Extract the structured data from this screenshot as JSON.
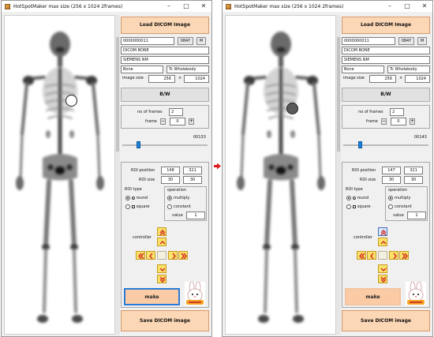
{
  "arrow_color": "#e11919",
  "windows": [
    {
      "title": "HotSpotMaker  max size (256 x 1024 2frames)",
      "load_button": "Load DICOM Image",
      "patient_id": "0000000011",
      "age": "084Y",
      "sex": "M",
      "study": "DICOM BONE",
      "manufacturer": "SIEMENS NM",
      "body_part": "Bone",
      "protocol": "Tc Wholebody",
      "image_size_label": "image size",
      "width": "256",
      "times": "×",
      "height": "1024",
      "bw_button": "B/W",
      "frames_label": "no of frames",
      "frames": "2",
      "frame_label": "frame",
      "frame": "0",
      "minus": "−",
      "plus": "+",
      "slider_value": "00133",
      "slider_fraction": 0.17,
      "roi_position_label": "ROI position",
      "roi_x": "148",
      "roi_y": "321",
      "roi_size_label": "ROI size",
      "roi_w": "30",
      "roi_h": "30",
      "roi_type_label": "ROI type",
      "round_label": "round",
      "square_label": "square",
      "operation_label": "operation",
      "multiply_label": "multiply",
      "constant_label": "constant",
      "value_label": "value",
      "value": "1",
      "controller_label": "controller",
      "make_button": "make",
      "save_button": "Save DICOM image",
      "roi_marker": "white-disc",
      "make_border": "#2a7ad6",
      "up_fast_selected": false
    },
    {
      "title": "HotSpotMaker  max size (256 x 1024 2frames)",
      "load_button": "Load DICOM Image",
      "patient_id": "0000000011",
      "age": "084Y",
      "sex": "M",
      "study": "DICOM BONE",
      "manufacturer": "SIEMENS NM",
      "body_part": "Bone",
      "protocol": "Tc Wholebody",
      "image_size_label": "image size",
      "width": "256",
      "times": "×",
      "height": "1024",
      "bw_button": "B/W",
      "frames_label": "no of frames",
      "frames": "2",
      "frame_label": "frame",
      "frame": "0",
      "minus": "−",
      "plus": "+",
      "slider_value": "00143",
      "slider_fraction": 0.18,
      "roi_position_label": "ROI position",
      "roi_x": "147",
      "roi_y": "321",
      "roi_size_label": "ROI size",
      "roi_w": "30",
      "roi_h": "30",
      "roi_type_label": "ROI type",
      "round_label": "round",
      "square_label": "square",
      "operation_label": "operation",
      "multiply_label": "multiply",
      "constant_label": "constant",
      "value_label": "value",
      "value": "1",
      "controller_label": "controller",
      "make_button": "make",
      "save_button": "Save DICOM image",
      "roi_marker": "dark-hot-spot",
      "make_border": "#f4c4a0",
      "up_fast_selected": true
    }
  ]
}
